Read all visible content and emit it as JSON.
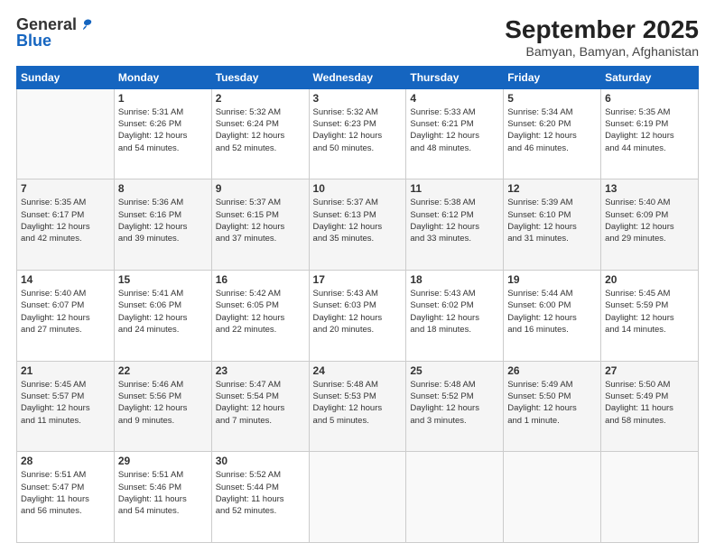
{
  "header": {
    "logo_general": "General",
    "logo_blue": "Blue",
    "title": "September 2025",
    "subtitle": "Bamyan, Bamyan, Afghanistan"
  },
  "weekdays": [
    "Sunday",
    "Monday",
    "Tuesday",
    "Wednesday",
    "Thursday",
    "Friday",
    "Saturday"
  ],
  "weeks": [
    [
      {
        "day": "",
        "info": ""
      },
      {
        "day": "1",
        "info": "Sunrise: 5:31 AM\nSunset: 6:26 PM\nDaylight: 12 hours\nand 54 minutes."
      },
      {
        "day": "2",
        "info": "Sunrise: 5:32 AM\nSunset: 6:24 PM\nDaylight: 12 hours\nand 52 minutes."
      },
      {
        "day": "3",
        "info": "Sunrise: 5:32 AM\nSunset: 6:23 PM\nDaylight: 12 hours\nand 50 minutes."
      },
      {
        "day": "4",
        "info": "Sunrise: 5:33 AM\nSunset: 6:21 PM\nDaylight: 12 hours\nand 48 minutes."
      },
      {
        "day": "5",
        "info": "Sunrise: 5:34 AM\nSunset: 6:20 PM\nDaylight: 12 hours\nand 46 minutes."
      },
      {
        "day": "6",
        "info": "Sunrise: 5:35 AM\nSunset: 6:19 PM\nDaylight: 12 hours\nand 44 minutes."
      }
    ],
    [
      {
        "day": "7",
        "info": "Sunrise: 5:35 AM\nSunset: 6:17 PM\nDaylight: 12 hours\nand 42 minutes."
      },
      {
        "day": "8",
        "info": "Sunrise: 5:36 AM\nSunset: 6:16 PM\nDaylight: 12 hours\nand 39 minutes."
      },
      {
        "day": "9",
        "info": "Sunrise: 5:37 AM\nSunset: 6:15 PM\nDaylight: 12 hours\nand 37 minutes."
      },
      {
        "day": "10",
        "info": "Sunrise: 5:37 AM\nSunset: 6:13 PM\nDaylight: 12 hours\nand 35 minutes."
      },
      {
        "day": "11",
        "info": "Sunrise: 5:38 AM\nSunset: 6:12 PM\nDaylight: 12 hours\nand 33 minutes."
      },
      {
        "day": "12",
        "info": "Sunrise: 5:39 AM\nSunset: 6:10 PM\nDaylight: 12 hours\nand 31 minutes."
      },
      {
        "day": "13",
        "info": "Sunrise: 5:40 AM\nSunset: 6:09 PM\nDaylight: 12 hours\nand 29 minutes."
      }
    ],
    [
      {
        "day": "14",
        "info": "Sunrise: 5:40 AM\nSunset: 6:07 PM\nDaylight: 12 hours\nand 27 minutes."
      },
      {
        "day": "15",
        "info": "Sunrise: 5:41 AM\nSunset: 6:06 PM\nDaylight: 12 hours\nand 24 minutes."
      },
      {
        "day": "16",
        "info": "Sunrise: 5:42 AM\nSunset: 6:05 PM\nDaylight: 12 hours\nand 22 minutes."
      },
      {
        "day": "17",
        "info": "Sunrise: 5:43 AM\nSunset: 6:03 PM\nDaylight: 12 hours\nand 20 minutes."
      },
      {
        "day": "18",
        "info": "Sunrise: 5:43 AM\nSunset: 6:02 PM\nDaylight: 12 hours\nand 18 minutes."
      },
      {
        "day": "19",
        "info": "Sunrise: 5:44 AM\nSunset: 6:00 PM\nDaylight: 12 hours\nand 16 minutes."
      },
      {
        "day": "20",
        "info": "Sunrise: 5:45 AM\nSunset: 5:59 PM\nDaylight: 12 hours\nand 14 minutes."
      }
    ],
    [
      {
        "day": "21",
        "info": "Sunrise: 5:45 AM\nSunset: 5:57 PM\nDaylight: 12 hours\nand 11 minutes."
      },
      {
        "day": "22",
        "info": "Sunrise: 5:46 AM\nSunset: 5:56 PM\nDaylight: 12 hours\nand 9 minutes."
      },
      {
        "day": "23",
        "info": "Sunrise: 5:47 AM\nSunset: 5:54 PM\nDaylight: 12 hours\nand 7 minutes."
      },
      {
        "day": "24",
        "info": "Sunrise: 5:48 AM\nSunset: 5:53 PM\nDaylight: 12 hours\nand 5 minutes."
      },
      {
        "day": "25",
        "info": "Sunrise: 5:48 AM\nSunset: 5:52 PM\nDaylight: 12 hours\nand 3 minutes."
      },
      {
        "day": "26",
        "info": "Sunrise: 5:49 AM\nSunset: 5:50 PM\nDaylight: 12 hours\nand 1 minute."
      },
      {
        "day": "27",
        "info": "Sunrise: 5:50 AM\nSunset: 5:49 PM\nDaylight: 11 hours\nand 58 minutes."
      }
    ],
    [
      {
        "day": "28",
        "info": "Sunrise: 5:51 AM\nSunset: 5:47 PM\nDaylight: 11 hours\nand 56 minutes."
      },
      {
        "day": "29",
        "info": "Sunrise: 5:51 AM\nSunset: 5:46 PM\nDaylight: 11 hours\nand 54 minutes."
      },
      {
        "day": "30",
        "info": "Sunrise: 5:52 AM\nSunset: 5:44 PM\nDaylight: 11 hours\nand 52 minutes."
      },
      {
        "day": "",
        "info": ""
      },
      {
        "day": "",
        "info": ""
      },
      {
        "day": "",
        "info": ""
      },
      {
        "day": "",
        "info": ""
      }
    ]
  ]
}
